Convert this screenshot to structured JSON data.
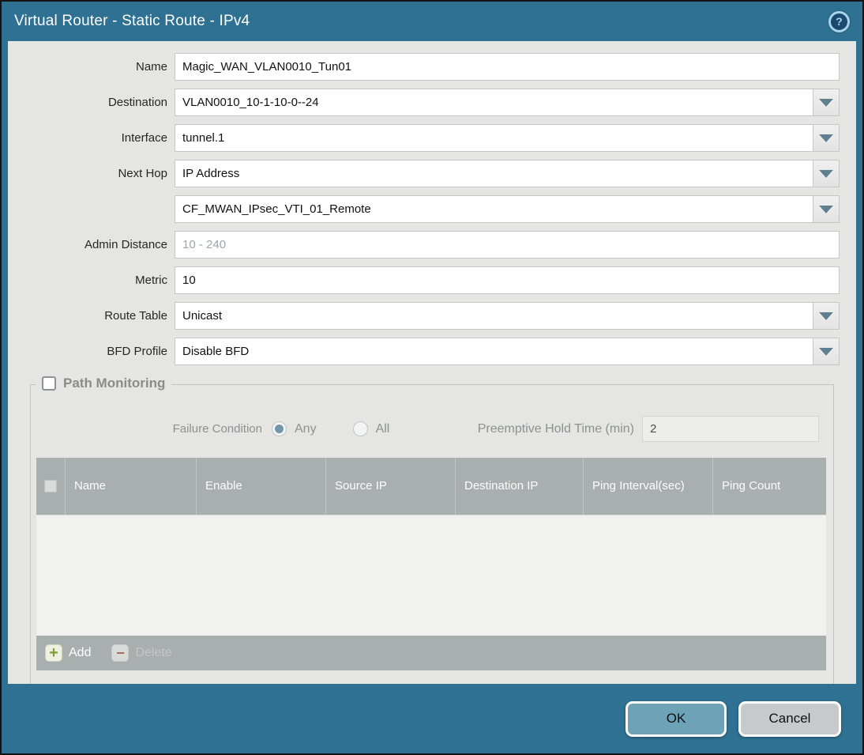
{
  "titlebar": {
    "title": "Virtual Router - Static Route - IPv4",
    "help_icon_glyph": "?"
  },
  "form": {
    "rows": [
      {
        "label": "Name",
        "value": "Magic_WAN_VLAN0010_Tun01",
        "type": "text"
      },
      {
        "label": "Destination",
        "value": "VLAN0010_10-1-10-0--24",
        "type": "combo"
      },
      {
        "label": "Interface",
        "value": "tunnel.1",
        "type": "combo"
      },
      {
        "label": "Next Hop",
        "value": "IP Address",
        "type": "combo"
      },
      {
        "label": "",
        "value": "CF_MWAN_IPsec_VTI_01_Remote",
        "type": "combo"
      },
      {
        "label": "Admin Distance",
        "value": "",
        "placeholder": "10 - 240",
        "type": "text"
      },
      {
        "label": "Metric",
        "value": "10",
        "type": "text"
      },
      {
        "label": "Route Table",
        "value": "Unicast",
        "type": "combo"
      },
      {
        "label": "BFD Profile",
        "value": "Disable BFD",
        "type": "combo"
      }
    ]
  },
  "path_monitoring": {
    "legend": "Path Monitoring",
    "checkbox_checked": false,
    "failure_condition": {
      "label": "Failure Condition",
      "options": [
        "Any",
        "All"
      ],
      "selected": "Any"
    },
    "preemptive_hold_time": {
      "label": "Preemptive Hold Time (min)",
      "value": "2"
    },
    "table": {
      "columns": [
        "Name",
        "Enable",
        "Source IP",
        "Destination IP",
        "Ping Interval(sec)",
        "Ping Count"
      ],
      "rows": []
    },
    "toolbar": {
      "add_label": "Add",
      "add_icon_glyph": "+",
      "delete_label": "Delete",
      "delete_icon_glyph": "−"
    }
  },
  "footer": {
    "ok_label": "OK",
    "cancel_label": "Cancel"
  },
  "colors": {
    "frame_teal": "#2f7192",
    "body_gray": "#e5e5e4",
    "table_header_gray": "#a9aeae",
    "ok_button": "#6ea2b7",
    "cancel_button": "#c7cacc",
    "add_icon_green": "#7f9c3a",
    "delete_icon_red": "#a26a62",
    "radio_selected": "#7297a9"
  }
}
